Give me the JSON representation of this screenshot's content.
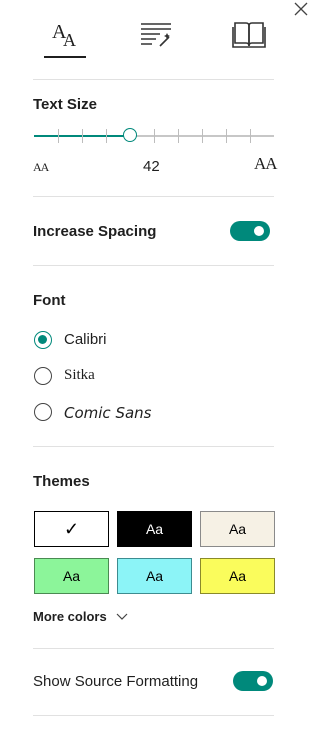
{
  "tabs": [
    {
      "name": "text-options",
      "icon": "text-size-icon",
      "active": true
    },
    {
      "name": "reading-preferences",
      "icon": "grammar-magic-icon",
      "active": false
    },
    {
      "name": "reading-mode",
      "icon": "book-icon",
      "active": false
    }
  ],
  "text_size": {
    "label": "Text Size",
    "value": "42",
    "small_icon": "AA",
    "large_icon": "AA",
    "fraction": 0.4
  },
  "spacing": {
    "label": "Increase Spacing",
    "enabled": true
  },
  "font": {
    "label": "Font",
    "options": [
      {
        "label": "Calibri",
        "selected": true
      },
      {
        "label": "Sitka",
        "selected": false
      },
      {
        "label": "Comic Sans",
        "selected": false
      }
    ]
  },
  "themes": {
    "label": "Themes",
    "swatches": [
      {
        "text": "✓",
        "bg": "#ffffff",
        "fg": "#000000",
        "border": "#000000"
      },
      {
        "text": "Aa",
        "bg": "#000000",
        "fg": "#ffffff",
        "border": "#000000"
      },
      {
        "text": "Aa",
        "bg": "#f6f1e5",
        "fg": "#000000",
        "border": "#8a8a8a"
      },
      {
        "text": "Aa",
        "bg": "#8cf59a",
        "fg": "#000000",
        "border": "#4a8a52"
      },
      {
        "text": "Aa",
        "bg": "#8cf4f7",
        "fg": "#000000",
        "border": "#3d8c90"
      },
      {
        "text": "Aa",
        "bg": "#fafc5c",
        "fg": "#000000",
        "border": "#8a8a2a"
      }
    ],
    "more_colors": "More colors"
  },
  "source_formatting": {
    "label": "Show Source Formatting",
    "enabled": true
  },
  "colors": {
    "accent": "#00897b"
  }
}
